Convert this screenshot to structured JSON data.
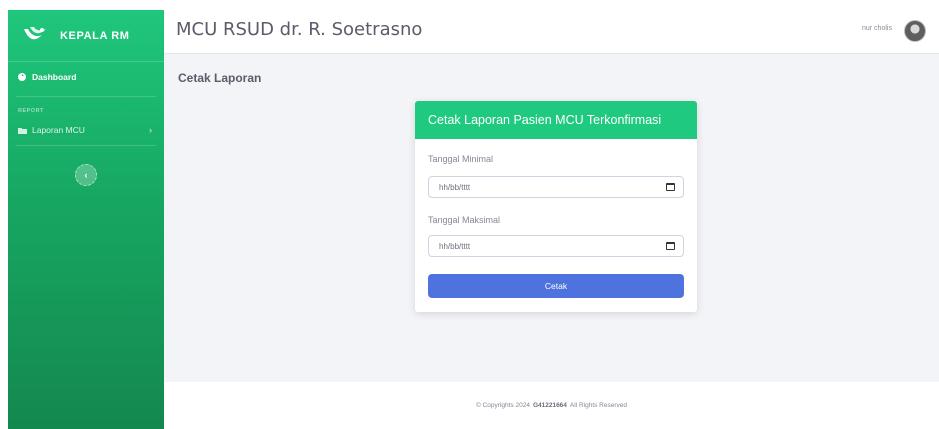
{
  "brand": {
    "name": "KEPALA RM"
  },
  "sidebar": {
    "dashboard_label": "Dashboard",
    "section_heading": "REPORT",
    "report_item_label": "Laporan MCU",
    "toggle_glyph": "‹"
  },
  "header": {
    "app_title": "MCU RSUD dr. R. Soetrasno",
    "user_name": "nur cholis"
  },
  "main": {
    "page_title": "Cetak Laporan",
    "card": {
      "title": "Cetak Laporan Pasien MCU Terkonfirmasi",
      "min_date_label": "Tanggal Minimal",
      "min_date_value": "hh/bb/tttt",
      "max_date_label": "Tanggal Maksimal",
      "max_date_value": "hh/bb/tttt",
      "submit_label": "Cetak"
    }
  },
  "footer": {
    "prefix": "© Copyrights 2024",
    "code": "G41221664",
    "suffix": "All Rights Reserved"
  },
  "icons": [
    "brand-logo-icon",
    "dashboard-icon",
    "folder-icon",
    "chevron-right-icon",
    "sidebar-toggle-icon",
    "avatar",
    "calendar-icon"
  ],
  "colors": {
    "sidebar_top": "#1fc77c",
    "sidebar_bottom": "#13884f",
    "card_header": "#1fca80",
    "button": "#4e73df",
    "content_bg": "#f3f4f8"
  }
}
